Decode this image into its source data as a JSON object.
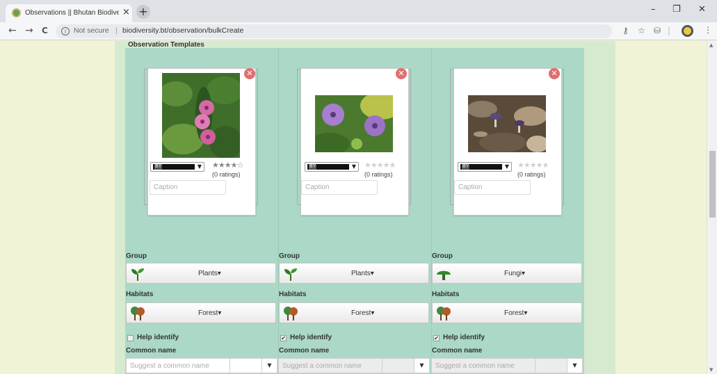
{
  "browser": {
    "tab_title": "Observations || Bhutan Biodivers",
    "tab_close": "×",
    "new_tab": "+",
    "minimize": "–",
    "restore": "❐",
    "close": "✕",
    "back": "←",
    "forward": "→",
    "reload": "C",
    "security_label": "Not secure",
    "url_separator": "|",
    "url": "biodiversity.bt/observation/bulkCreate"
  },
  "page": {
    "section_title": "Observation Templates"
  },
  "cards": [
    {
      "license_label": "BY",
      "rating_stars": "★★★★☆",
      "ratings_text": "(0 ratings)",
      "caption_placeholder": "Caption",
      "photo_subject": "pink-flowers-photo"
    },
    {
      "license_label": "BY",
      "rating_stars": "★★★★★",
      "ratings_text": "(0 ratings)",
      "caption_placeholder": "Caption",
      "photo_subject": "purple-flowers-photo"
    },
    {
      "license_label": "BY",
      "rating_stars": "★★★★★",
      "ratings_text": "(0 ratings)",
      "caption_placeholder": "Caption",
      "photo_subject": "fungi-photo"
    }
  ],
  "columns": [
    {
      "group_label": "Group",
      "group_value": "Plants▾",
      "group_icon": "plant-icon",
      "habitats_label": "Habitats",
      "habitat_value": "Forest▾",
      "help_label": "Help identify",
      "help_checked": false,
      "common_name_label": "Common name",
      "common_name_placeholder": "Suggest a common name"
    },
    {
      "group_label": "Group",
      "group_value": "Plants▾",
      "group_icon": "plant-icon",
      "habitats_label": "Habitats",
      "habitat_value": "Forest▾",
      "help_label": "Help identify",
      "help_checked": true,
      "common_name_label": "Common name",
      "common_name_placeholder": "Suggest a common name"
    },
    {
      "group_label": "Group",
      "group_value": "Fungi▾",
      "group_icon": "mushroom-icon",
      "habitats_label": "Habitats",
      "habitat_value": "Forest▾",
      "help_label": "Help identify",
      "help_checked": true,
      "common_name_label": "Common name",
      "common_name_placeholder": "Suggest a common name"
    }
  ],
  "colors": {
    "panel": "#abd8c7",
    "page_bg": "#f0f3d6",
    "remove": "#e06f6f"
  }
}
